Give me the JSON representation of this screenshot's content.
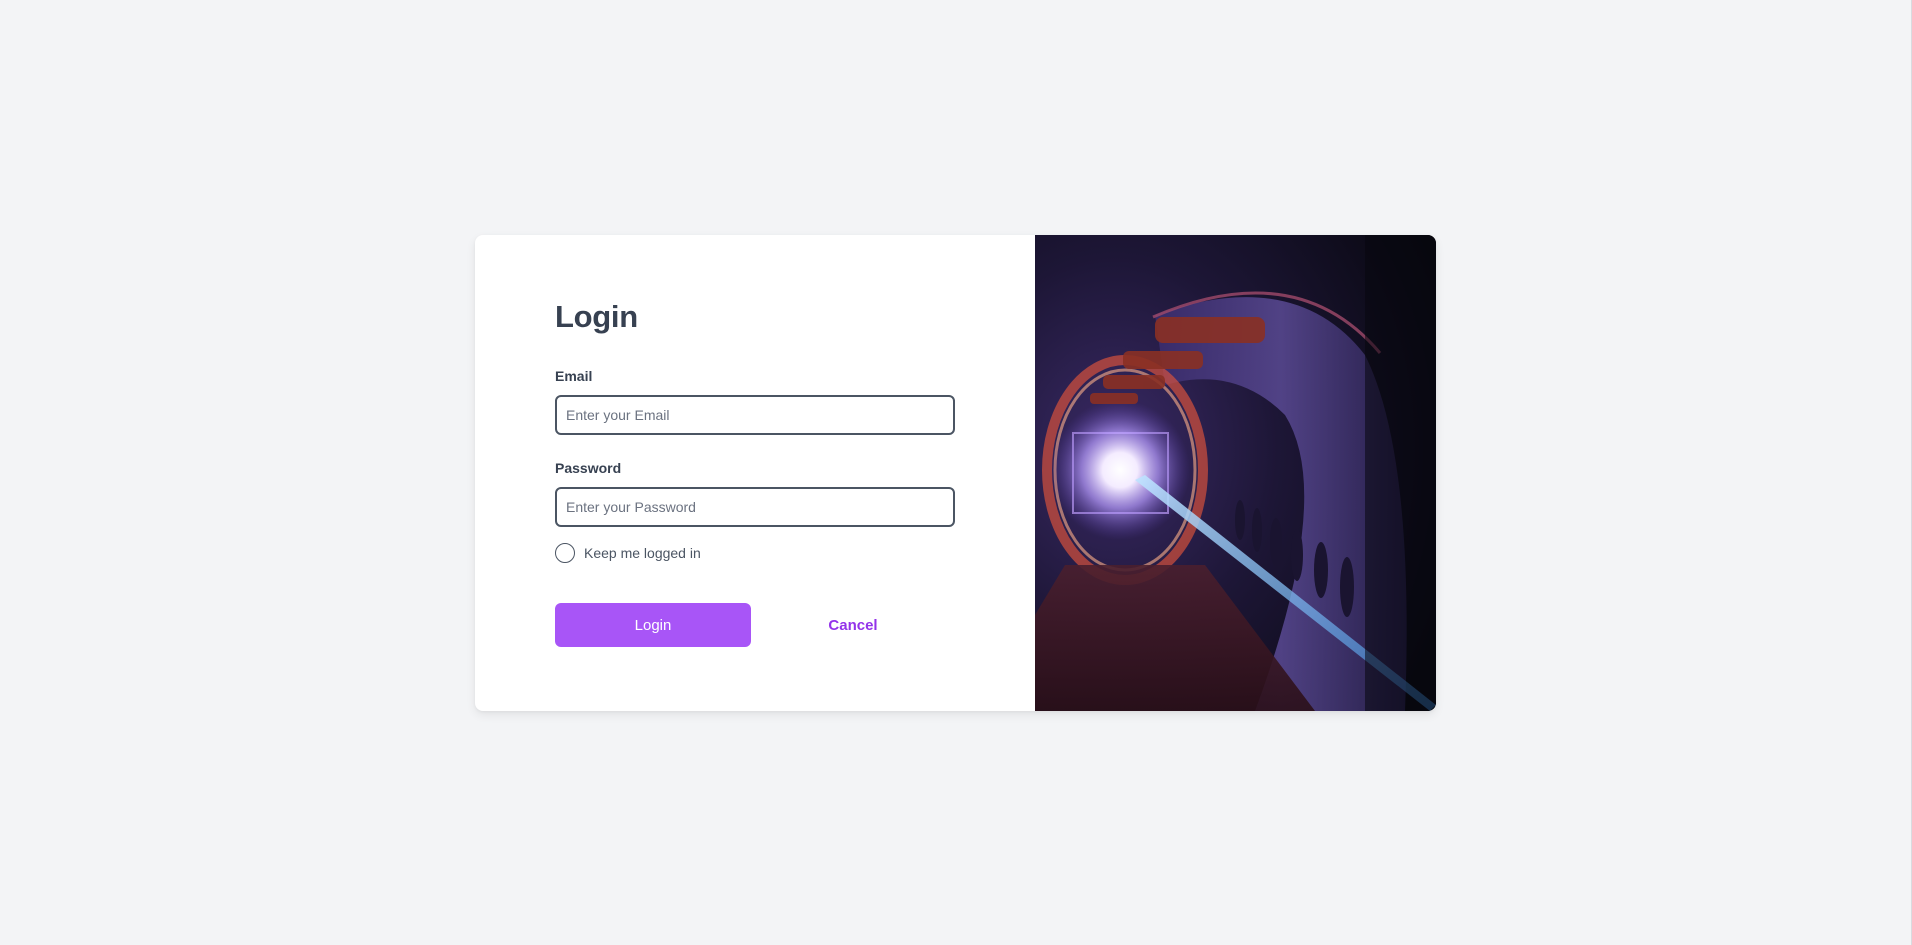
{
  "login_form": {
    "title": "Login",
    "email": {
      "label": "Email",
      "placeholder": "Enter your Email",
      "value": ""
    },
    "password": {
      "label": "Password",
      "placeholder": "Enter your Password",
      "value": ""
    },
    "remember_me": {
      "label": "Keep me logged in",
      "checked": false
    },
    "login_button_label": "Login",
    "cancel_button_label": "Cancel"
  },
  "hero_image": {
    "subject": "tunnel-light-image"
  },
  "colors": {
    "background": "#f3f4f6",
    "card": "#ffffff",
    "accent": "#a855f7",
    "accent_text": "#9333ea",
    "text": "#374151",
    "input_border": "#4b5563"
  }
}
